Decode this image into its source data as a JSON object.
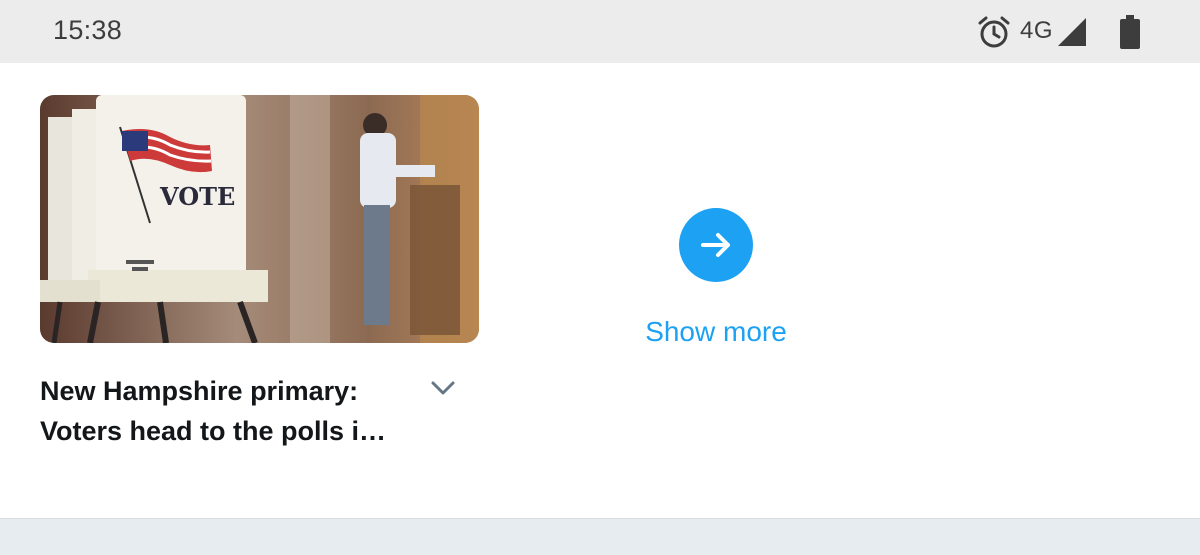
{
  "status_bar": {
    "time": "15:38",
    "network": "4G",
    "icons": [
      "alarm-icon",
      "signal-icon",
      "battery-icon"
    ]
  },
  "card": {
    "image_subject": "voting booth with VOTE sign and American flag",
    "title_line1": "New Hampshire primary:",
    "title_line2": "Voters head to the polls i…",
    "menu_icon": "chevron-down-icon"
  },
  "show_more": {
    "label": "Show more",
    "icon": "arrow-right-icon"
  },
  "colors": {
    "accent": "#1da1f2",
    "status_bar_bg": "#ececec",
    "separator": "#e6ecf0",
    "title_text": "#14171a"
  }
}
